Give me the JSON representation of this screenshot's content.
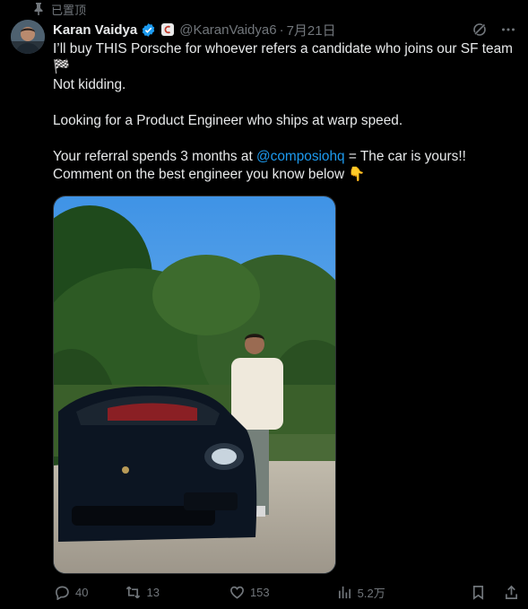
{
  "pinned_label": "已置顶",
  "author": {
    "name": "Karan Vaidya",
    "handle": "@KaranVaidya6",
    "date": "7月21日"
  },
  "tweet": {
    "line1": "I’ll buy THIS Porsche for whoever refers a candidate who joins our SF team",
    "flag_emoji": "🏁",
    "line2": "Not kidding.",
    "line3": "Looking for a Product Engineer who ships at warp speed.",
    "line4_pre": "Your referral spends 3 months at ",
    "line4_mention": "@composiohq",
    "line4_post": " = The car is yours!!",
    "line5": "Comment on the best engineer you know below 👇"
  },
  "actions": {
    "replies": "40",
    "retweets": "13",
    "likes": "153",
    "views": "5.2万"
  },
  "colors": {
    "background": "#000000",
    "text": "#e7e9ea",
    "muted": "#71767b",
    "accent": "#1d9bf0"
  }
}
